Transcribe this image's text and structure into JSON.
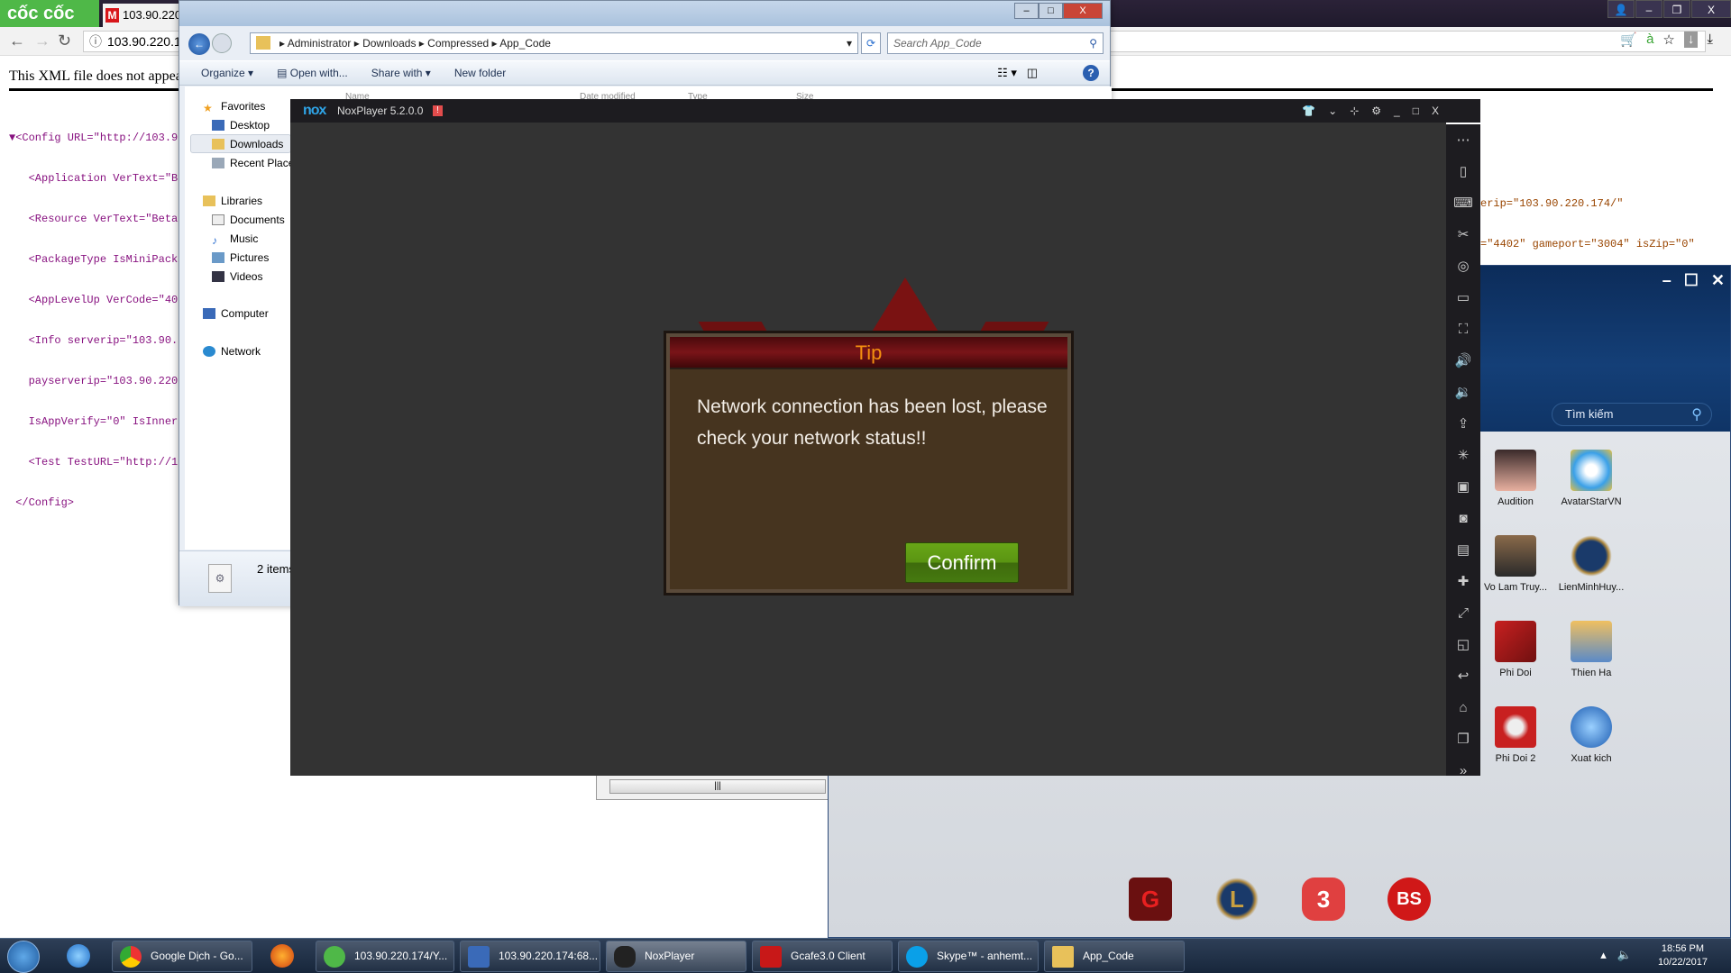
{
  "browser": {
    "brand": "cốc cốc",
    "tab_title": "103.90.220.",
    "address": "103.90.220.1",
    "xml_notice": "This XML file does not appea",
    "xml_lines": [
      "▼<Config URL=\"http://103.9",
      "   <Application VerText=\"B",
      "   <Resource VerText=\"Beta",
      "   <PackageType IsMiniPack",
      "   <AppLevelUp VerCode=\"40",
      "   <Info serverip=\"103.90.",
      "   payserverip=\"103.90.220",
      "   IsAppVerify=\"0\" IsInner",
      "   <Test TestURL=\"http://1",
      " </Config>"
    ],
    "xml_right_lines": [
      "erip=\"103.90.220.174/\"",
      "=\"4402\" gameport=\"3004\" isZip=\"0\""
    ]
  },
  "explorer": {
    "breadcrumb": [
      "Administrator",
      "Downloads",
      "Compressed",
      "App_Code"
    ],
    "search_placeholder": "Search App_Code",
    "toolbar": {
      "organize": "Organize ▾",
      "open_with": "Open with...",
      "share_with": "Share with ▾",
      "new_folder": "New folder"
    },
    "columns": [
      "Name",
      "Date modified",
      "Type",
      "Size"
    ],
    "nav": {
      "favorites": "Favorites",
      "favorites_items": [
        "Desktop",
        "Downloads",
        "Recent Places"
      ],
      "libraries": "Libraries",
      "libraries_items": [
        "Documents",
        "Music",
        "Pictures",
        "Videos"
      ],
      "computer": "Computer",
      "network": "Network"
    },
    "status": "2 items"
  },
  "nox": {
    "logo": "nox",
    "title": "NoxPlayer 5.2.0.0",
    "alert": "!",
    "dialog": {
      "title": "Tip",
      "message": "Network connection has been lost, please check your network status!!",
      "confirm": "Confirm"
    }
  },
  "launcher": {
    "search_placeholder": "Tìm kiếm",
    "apps": [
      "Audition",
      "AvatarStarVN",
      "Vo Lam Truy...",
      "LienMinhHuy...",
      "Phi Doi",
      "Thien Ha",
      "Phi Doi 2",
      "Xuat kich"
    ],
    "dock_labels": [
      "G",
      "L",
      "3",
      "BS"
    ]
  },
  "taskbar": {
    "items": [
      "Google Dịch - Go...",
      "103.90.220.174/Y...",
      "103.90.220.174:68...",
      "NoxPlayer",
      "Gcafe3.0 Client",
      "Skype™ - anhemt...",
      "App_Code"
    ],
    "time": "18:56 PM",
    "date": "10/22/2017"
  },
  "colors": {
    "nox_bg": "#333333",
    "dialog_title": "#f49010",
    "confirm_green": "#5a9412",
    "launcher_header": "#0f3466"
  }
}
